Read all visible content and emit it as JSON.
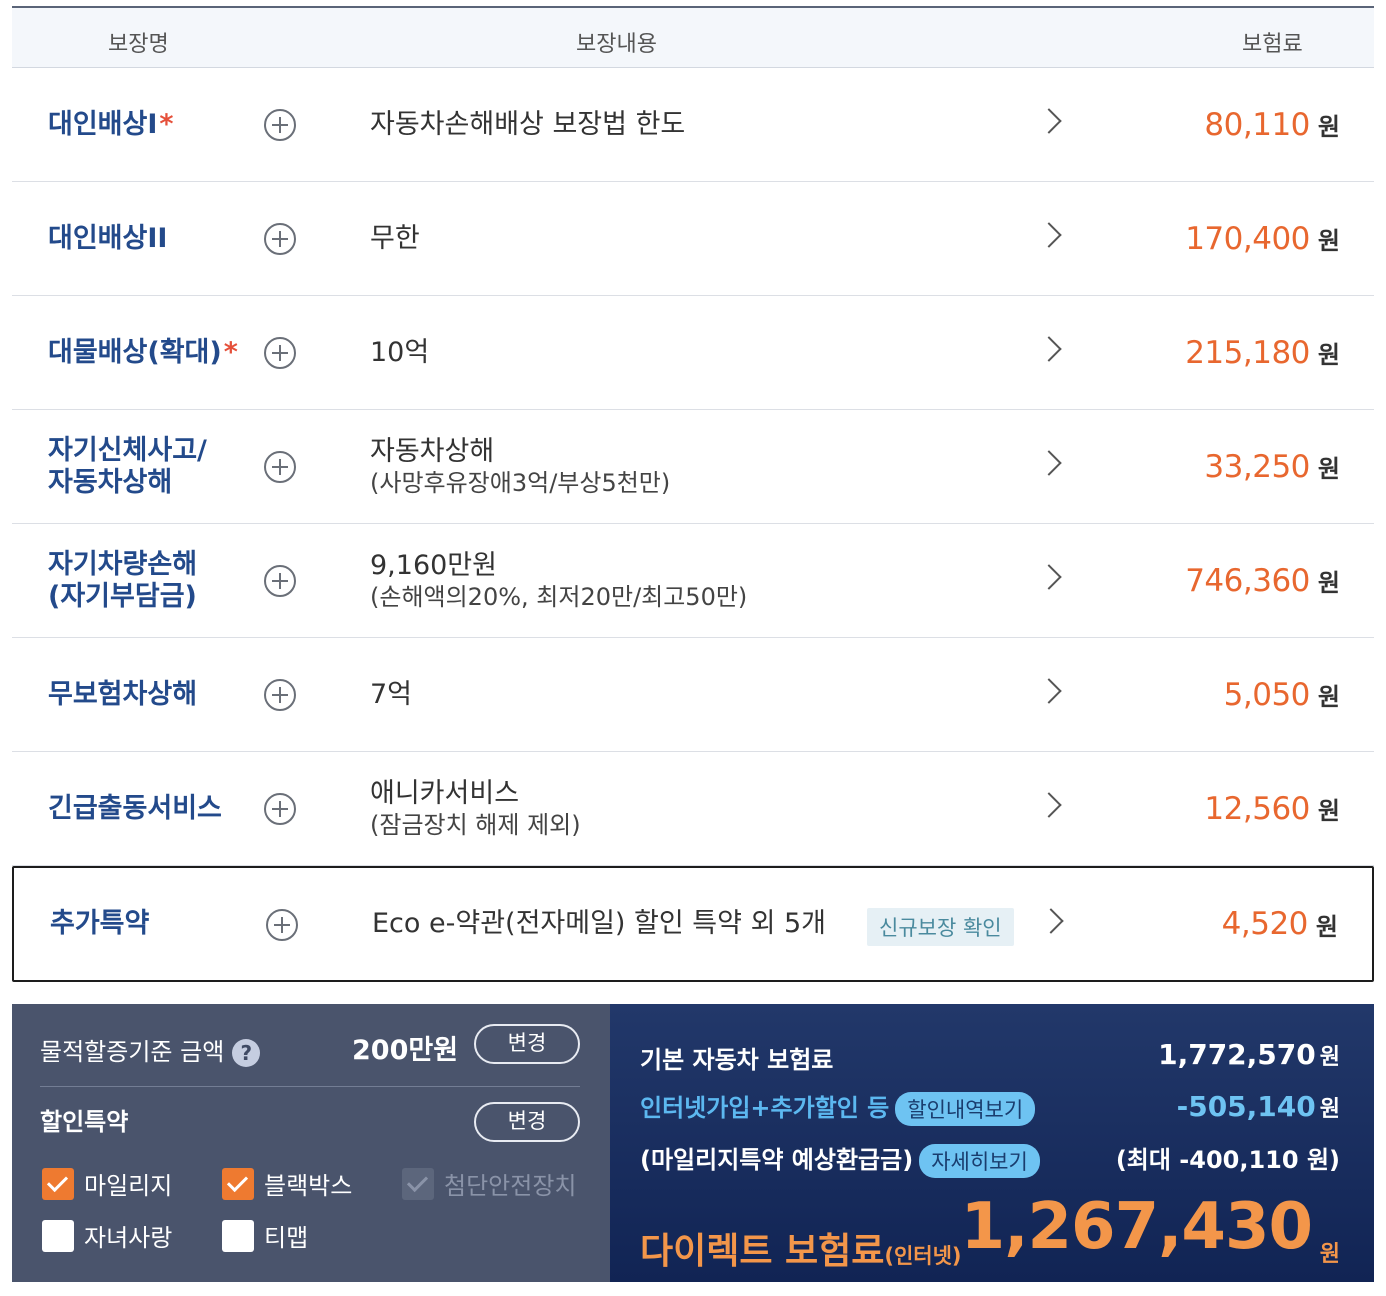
{
  "table": {
    "headers": {
      "name": "보장명",
      "desc": "보장내용",
      "premium": "보험료"
    },
    "rows": [
      {
        "name": "대인배상I",
        "required": "*",
        "desc": "자동차손해배상 보장법 한도",
        "sub": "",
        "amount": "80,110",
        "unit": "원"
      },
      {
        "name": "대인배상II",
        "required": "",
        "desc": "무한",
        "sub": "",
        "amount": "170,400",
        "unit": "원"
      },
      {
        "name": "대물배상(확대)",
        "required": "*",
        "desc": "10억",
        "sub": "",
        "amount": "215,180",
        "unit": "원"
      },
      {
        "name": "자기신체사고/\n자동차상해",
        "required": "",
        "desc": "자동차상해",
        "sub": "(사망후유장애3억/부상5천만)",
        "amount": "33,250",
        "unit": "원"
      },
      {
        "name": "자기차량손해\n(자기부담금)",
        "required": "",
        "desc": "9,160만원",
        "sub": "(손해액의20%, 최저20만/최고50만)",
        "amount": "746,360",
        "unit": "원"
      },
      {
        "name": "무보험차상해",
        "required": "",
        "desc": "7억",
        "sub": "",
        "amount": "5,050",
        "unit": "원"
      },
      {
        "name": "긴급출동서비스",
        "required": "",
        "desc": "애니카서비스",
        "sub": "(잠금장치 해제 제외)",
        "amount": "12,560",
        "unit": "원"
      },
      {
        "name": "추가특약",
        "required": "",
        "desc": "Eco e-약관(전자메일) 할인 특약 외 5개",
        "sub": "",
        "badge": "신규보장 확인",
        "amount": "4,520",
        "unit": "원"
      }
    ]
  },
  "left_panel": {
    "threshold_label": "물적할증기준 금액",
    "help_icon": "question-icon",
    "threshold_value": "200만원",
    "change_button": "변경",
    "discount_label": "할인특약",
    "discount_change_button": "변경",
    "options": [
      {
        "label": "마일리지",
        "checked": true,
        "disabled": false
      },
      {
        "label": "블랙박스",
        "checked": true,
        "disabled": false
      },
      {
        "label": "첨단안전장치",
        "checked": true,
        "disabled": true
      },
      {
        "label": "자녀사랑",
        "checked": false,
        "disabled": false
      },
      {
        "label": "티맵",
        "checked": false,
        "disabled": false
      }
    ]
  },
  "right_panel": {
    "base_label": "기본 자동차 보험료",
    "base_value": "1,772,570",
    "internet_label": "인터넷가입+추가할인 등",
    "internet_pill": "할인내역보기",
    "internet_value": "-505,140",
    "mileage_label": "(마일리지특약 예상환급금)",
    "mileage_pill": "자세히보기",
    "mileage_value": "(최대 -400,110 원)",
    "final_label": "다이렉트 보험료",
    "final_suffix": "(인터넷)",
    "final_value": "1,267,430",
    "unit": "원"
  },
  "colors": {
    "accent_orange": "#e8672f",
    "title_blue": "#234a8b",
    "panel_left": "#4a546c",
    "panel_right": "#1a2e60"
  }
}
